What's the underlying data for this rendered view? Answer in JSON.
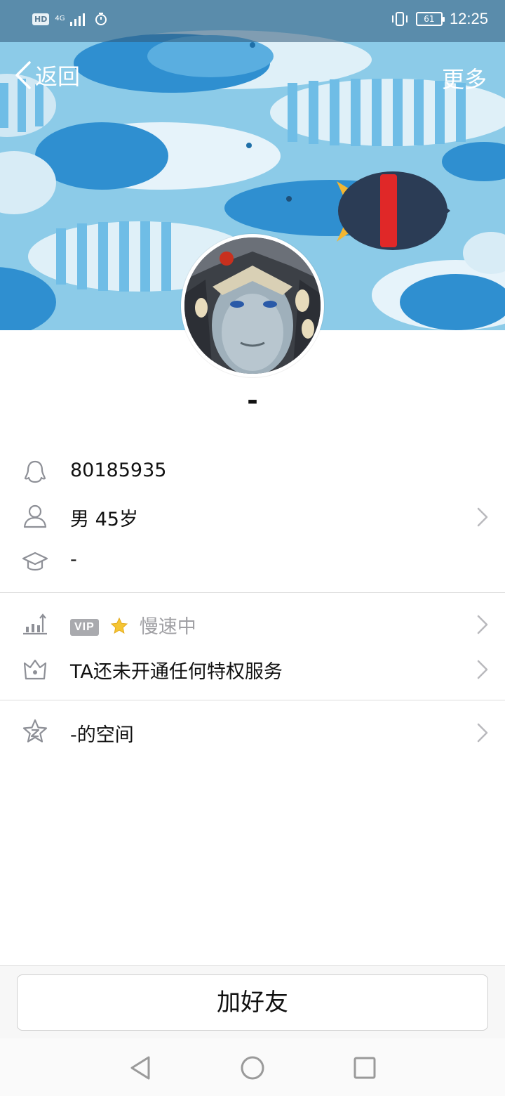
{
  "status_bar": {
    "hd": "HD",
    "network": "4G",
    "battery": "61",
    "time": "12:25"
  },
  "nav": {
    "back_label": "返回",
    "more_label": "更多"
  },
  "profile": {
    "nickname": "-",
    "qq_number": "80185935",
    "gender_age": "男  45岁",
    "school": "-"
  },
  "vip": {
    "badge": "VIP",
    "status": "慢速中",
    "privilege_text": "TA还未开通任何特权服务"
  },
  "space": {
    "label": "-的空间"
  },
  "actions": {
    "add_friend": "加好友"
  },
  "colors": {
    "cover_bg": "#8ccbe8",
    "fish_dark": "#2f8fd0",
    "fish_light": "#d8ecf6",
    "icon_grey": "#8e9097",
    "chevron": "#b9b9bd",
    "vip_badge": "#a9aaae",
    "star": "#f5c533"
  }
}
